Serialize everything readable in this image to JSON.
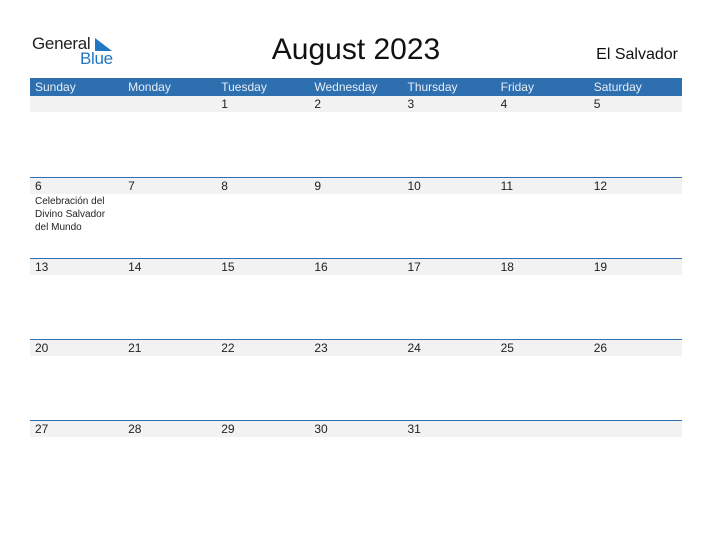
{
  "logo": {
    "general": "General",
    "blue": "Blue"
  },
  "title": "August 2023",
  "country": "El Salvador",
  "colors": {
    "accent": "#2e6fb0",
    "date_strip": "#f2f2f2",
    "logo_blue": "#1f78c1"
  },
  "weekdays": [
    "Sunday",
    "Monday",
    "Tuesday",
    "Wednesday",
    "Thursday",
    "Friday",
    "Saturday"
  ],
  "weeks": [
    [
      {
        "d": ""
      },
      {
        "d": ""
      },
      {
        "d": "1"
      },
      {
        "d": "2"
      },
      {
        "d": "3"
      },
      {
        "d": "4"
      },
      {
        "d": "5"
      }
    ],
    [
      {
        "d": "6",
        "e": "Celebración del Divino Salvador del Mundo"
      },
      {
        "d": "7"
      },
      {
        "d": "8"
      },
      {
        "d": "9"
      },
      {
        "d": "10"
      },
      {
        "d": "11"
      },
      {
        "d": "12"
      }
    ],
    [
      {
        "d": "13"
      },
      {
        "d": "14"
      },
      {
        "d": "15"
      },
      {
        "d": "16"
      },
      {
        "d": "17"
      },
      {
        "d": "18"
      },
      {
        "d": "19"
      }
    ],
    [
      {
        "d": "20"
      },
      {
        "d": "21"
      },
      {
        "d": "22"
      },
      {
        "d": "23"
      },
      {
        "d": "24"
      },
      {
        "d": "25"
      },
      {
        "d": "26"
      }
    ],
    [
      {
        "d": "27"
      },
      {
        "d": "28"
      },
      {
        "d": "29"
      },
      {
        "d": "30"
      },
      {
        "d": "31"
      },
      {
        "d": ""
      },
      {
        "d": ""
      }
    ]
  ]
}
